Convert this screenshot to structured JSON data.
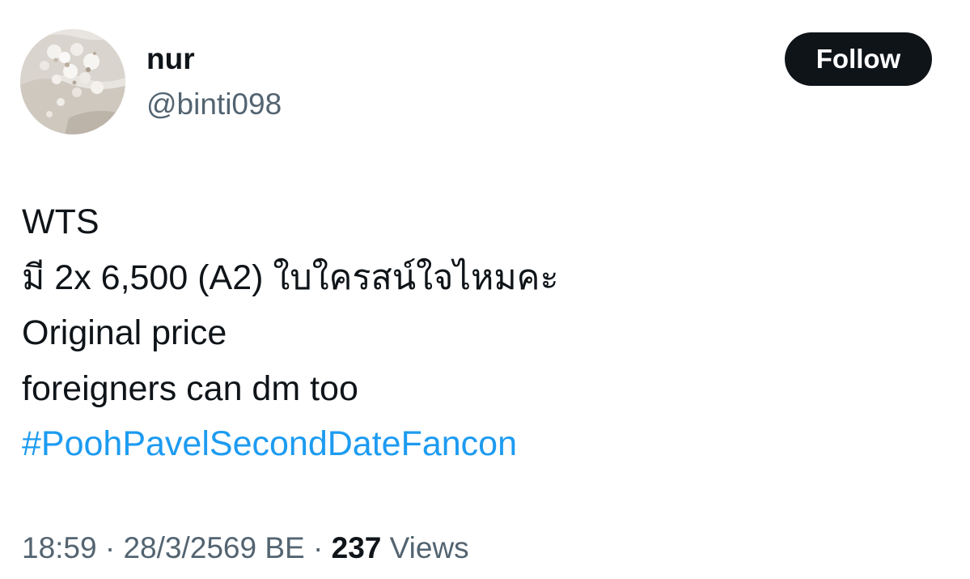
{
  "author": {
    "display_name": "nur",
    "handle": "@binti098",
    "avatar_icon": "profile-photo-avatar"
  },
  "follow_button": {
    "label": "Follow"
  },
  "tweet": {
    "lines": [
      "WTS",
      "มี 2x 6,500 (A2) ใบใครสน์ใจไหมคะ",
      "Original price",
      "foreigners can dm too"
    ],
    "hashtag": "#PoohPavelSecondDateFancon"
  },
  "meta": {
    "time": "18:59",
    "separator": " · ",
    "date": "28/3/2569 BE",
    "views_count": "237",
    "views_label": "Views"
  },
  "colors": {
    "text_primary": "#0f1419",
    "text_secondary": "#536471",
    "link": "#1d9bf0",
    "button_bg": "#0f1419",
    "button_text": "#ffffff"
  }
}
